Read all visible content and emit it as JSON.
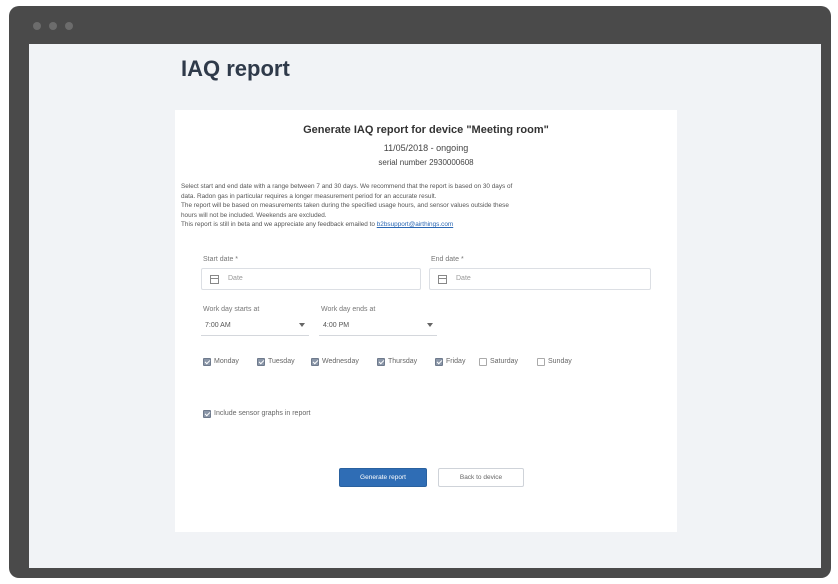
{
  "page": {
    "title": "IAQ report"
  },
  "card": {
    "heading": "Generate IAQ report for device \"Meeting room\"",
    "date_range": "11/05/2018 - ongoing",
    "serial": "serial number 2930000608",
    "description": [
      "Select start and end date with a range between 7 and 30 days. We recommend that the report is based on 30 days of",
      "data. Radon gas in particular requires a longer measurement period for an accurate result.",
      "The report will be based on measurements taken during the specified usage hours, and sensor values outside these",
      "hours will not be included. Weekends are excluded."
    ],
    "beta_note": "This report is still in beta and we appreciate any feedback emailed to ",
    "feedback_email": "b2bsupport@airthings.com"
  },
  "form": {
    "start_date": {
      "label": "Start date *",
      "placeholder": "Date"
    },
    "end_date": {
      "label": "End date *",
      "placeholder": "Date"
    },
    "work_start": {
      "label": "Work day starts at",
      "value": "7:00 AM"
    },
    "work_end": {
      "label": "Work day ends at",
      "value": "4:00 PM"
    },
    "days": [
      {
        "label": "Monday",
        "checked": true
      },
      {
        "label": "Tuesday",
        "checked": true
      },
      {
        "label": "Wednesday",
        "checked": true
      },
      {
        "label": "Thursday",
        "checked": true
      },
      {
        "label": "Friday",
        "checked": true
      },
      {
        "label": "Saturday",
        "checked": false
      },
      {
        "label": "Sunday",
        "checked": false
      }
    ],
    "include_graphs": {
      "label": "Include sensor graphs in report",
      "checked": true
    }
  },
  "buttons": {
    "generate": "Generate report",
    "back": "Back to device"
  }
}
